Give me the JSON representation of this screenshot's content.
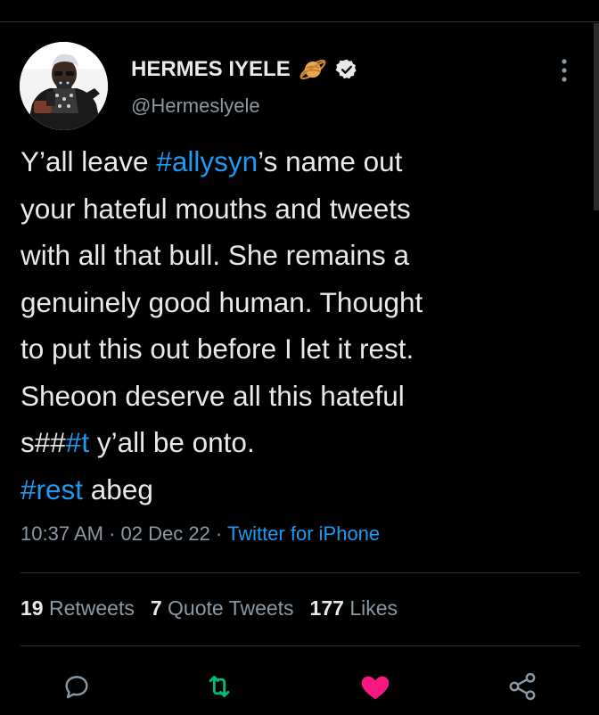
{
  "user": {
    "display_name": "HERMES IYELE",
    "handle": "@Hermeslyele",
    "emoji_icon": "ringed-planet-icon",
    "verified_icon": "verified-badge-icon"
  },
  "tweet": {
    "l1_before": "Y’all leave ",
    "l1_tag": "#allysyn",
    "l1_after": "’s name out",
    "l2": "your hateful mouths and tweets",
    "l3": "with all that bull. She remains a",
    "l4": "genuinely good human. Thought",
    "l5": "to put this out before I let it rest.",
    "l6": "Sheoon deserve all this hateful",
    "l7_before": "s##",
    "l7_tag": "#t",
    "l7_after": " y’all be onto.",
    "l8_tag": "#rest",
    "l8_after": " abeg"
  },
  "meta": {
    "time": "10:37 AM",
    "sep1": " · ",
    "date": "02 Dec 22",
    "sep2": " · ",
    "source": "Twitter for iPhone"
  },
  "stats": {
    "retweets_count": "19",
    "retweets_label": "Retweets",
    "quotes_count": "7",
    "quotes_label": "Quote Tweets",
    "likes_count": "177",
    "likes_label": "Likes"
  },
  "actions": {
    "reply_icon": "reply-icon",
    "retweet_icon": "retweet-icon",
    "like_icon": "heart-icon",
    "share_icon": "share-icon"
  },
  "colors": {
    "background": "#000000",
    "text": "#e7e9ea",
    "muted": "#8b98a5",
    "link": "#1d9bf0",
    "retweet_active": "#00ba7c",
    "like_active": "#f91880",
    "divider": "#2f3336"
  }
}
